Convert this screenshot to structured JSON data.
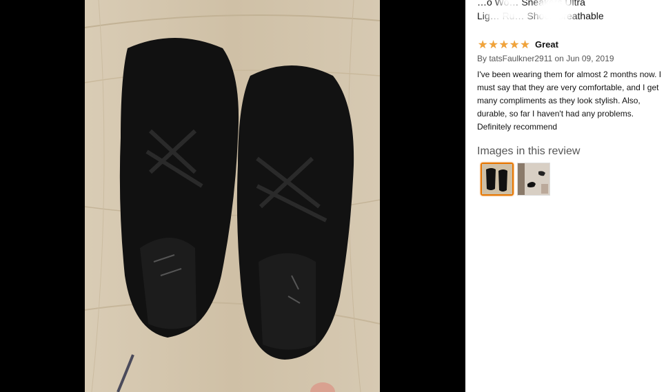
{
  "product": {
    "title_line1": "…o Wo… Sneakers Ultra",
    "title_line2": "Lig… Ru… Shoes Breathable"
  },
  "review": {
    "rating": 5,
    "rating_max": 5,
    "title": "Great",
    "byline": "By tatsFaulkner2911 on Jun 09, 2019",
    "body": "I've been wearing them for almost 2 months now. I must say that they are very comfortable, and I get many compliments as they look stylish. Also, durable, so far I haven't had any problems. Definitely recommend"
  },
  "images_section": {
    "heading": "Images in this review",
    "thumbnails": [
      {
        "name": "thumbnail-1",
        "selected": true
      },
      {
        "name": "thumbnail-2",
        "selected": false
      }
    ]
  },
  "colors": {
    "viewer_background": "#000000",
    "star": "#f1a33a",
    "selected_border": "#e77600"
  }
}
